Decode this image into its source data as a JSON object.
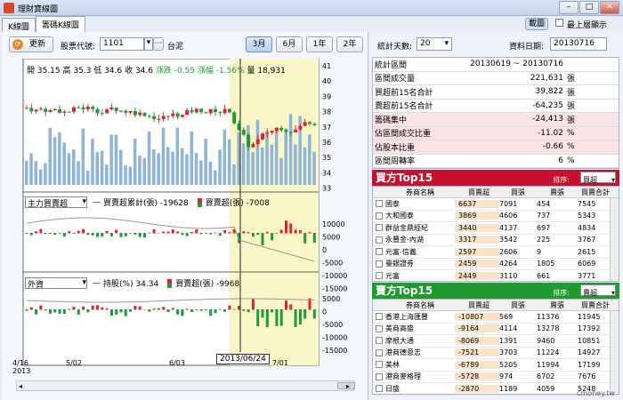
{
  "window": {
    "title": "理財寶線圖",
    "restore_label": "歐圖",
    "minimize": "–",
    "maximize": "□",
    "close": "✕"
  },
  "tabs": [
    {
      "label": "K線圖"
    },
    {
      "label": "籌碼K線圖"
    }
  ],
  "top_right": {
    "load_label": "載圖",
    "topmost_label": "最上層顯示"
  },
  "toolbar": {
    "refresh_label": "更新",
    "stock_code_label": "股票代號:",
    "stock_code_value": "1101",
    "stock_name": "台泥",
    "ranges": [
      "3月",
      "6月",
      "1年",
      "2年"
    ],
    "selected_range": "3月"
  },
  "right_toolbar": {
    "days_label": "統計天數:",
    "days_value": "20",
    "date_label": "資料日期:",
    "date_value": "20130716"
  },
  "price_header": {
    "open": "開 35.15",
    "high": "高 35.3",
    "low": "低 34.6",
    "close": "收 34.6",
    "change": "漲跌 -0.55",
    "pct": "漲幅 -1.56%",
    "vol": "量 18,931"
  },
  "panel2": {
    "dropdown": "主力買賣超",
    "line_legend": "買賣超累計(張) -19628",
    "bar_legend": "買賣超(張) -7008"
  },
  "panel3": {
    "dropdown": "外資",
    "line_legend": "持股(%) 34.34",
    "bar_legend": "買賣超(張) -9968"
  },
  "x_labels": [
    "4/16\n2013",
    "5/02",
    "6/03",
    "7/01"
  ],
  "crosshair_date": "2013/06/24",
  "price_axis": [
    "41",
    "40",
    "39",
    "38",
    "37",
    "36",
    "35",
    "34",
    "33"
  ],
  "panel2_axis": [
    "10000",
    "5000",
    "0",
    "-5000",
    "-10000",
    "-15000"
  ],
  "panel3_axis": [
    "5000",
    "0",
    "-5000",
    "-10000",
    "-15000"
  ],
  "stats": [
    {
      "label": "統計區間",
      "value": "20130619 ~ 20130716",
      "unit": "",
      "pink": false
    },
    {
      "label": "區間成交量",
      "value": "221,631",
      "unit": "張",
      "pink": false
    },
    {
      "label": "買超前15名合計",
      "value": "39,822",
      "unit": "張",
      "pink": false
    },
    {
      "label": "賣超前15名合計",
      "value": "-64,235",
      "unit": "張",
      "pink": false
    },
    {
      "label": "籌碼集中",
      "value": "-24,413",
      "unit": "張",
      "pink": true
    },
    {
      "label": "佔區間成交比重",
      "value": "-11.02",
      "unit": "%",
      "pink": true
    },
    {
      "label": "佔股本比重",
      "value": "-0.66",
      "unit": "%",
      "pink": true
    },
    {
      "label": "區間周轉率",
      "value": "6",
      "unit": "%",
      "pink": false
    }
  ],
  "buy_top": {
    "title": "買方Top15",
    "sort_label": "排序:",
    "sort_value": "買超",
    "headers": [
      "券商名稱",
      "買賣超",
      "買張",
      "賣張",
      "買賣合計"
    ],
    "rows": [
      [
        "國泰",
        "6637",
        "7091",
        "454",
        "7545"
      ],
      [
        "大和國泰",
        "3869",
        "4606",
        "737",
        "5343"
      ],
      [
        "群益金鼎經紀",
        "3440",
        "4137",
        "697",
        "4834"
      ],
      [
        "永豐金-內湖",
        "3317",
        "3542",
        "225",
        "3767"
      ],
      [
        "元富-信義",
        "2597",
        "2606",
        "9",
        "2615"
      ],
      [
        "臺銀證券",
        "2459",
        "4264",
        "1805",
        "6069"
      ],
      [
        "元富",
        "2449",
        "3110",
        "661",
        "3771"
      ]
    ]
  },
  "sell_top": {
    "title": "賣方Top15",
    "sort_label": "排序:",
    "sort_value": "賣超",
    "headers": [
      "券商名稱",
      "買賣超",
      "買張",
      "賣張",
      "買賣合計"
    ],
    "rows": [
      [
        "香港上海匯豐",
        "-10807",
        "569",
        "11376",
        "11945"
      ],
      [
        "美商高盛",
        "-9164",
        "4114",
        "13278",
        "17392"
      ],
      [
        "摩根大通",
        "-8069",
        "1391",
        "9460",
        "10851"
      ],
      [
        "港商德意志",
        "-7521",
        "3703",
        "11224",
        "14927"
      ],
      [
        "美林",
        "-6789",
        "5205",
        "11994",
        "17199"
      ],
      [
        "港商麥格理",
        "-5728",
        "974",
        "6702",
        "7676"
      ],
      [
        "日盛",
        "-2870",
        "1189",
        "4059",
        "5248"
      ]
    ]
  },
  "watermark": "cmoney.tw",
  "colors": {
    "buy_head": "#c8102e",
    "sell_head": "#1e9a2e",
    "up": "#e3232c",
    "down": "#1f9a3a",
    "volume": "#8fb3d9",
    "highlight": "#fbf6c8"
  }
}
